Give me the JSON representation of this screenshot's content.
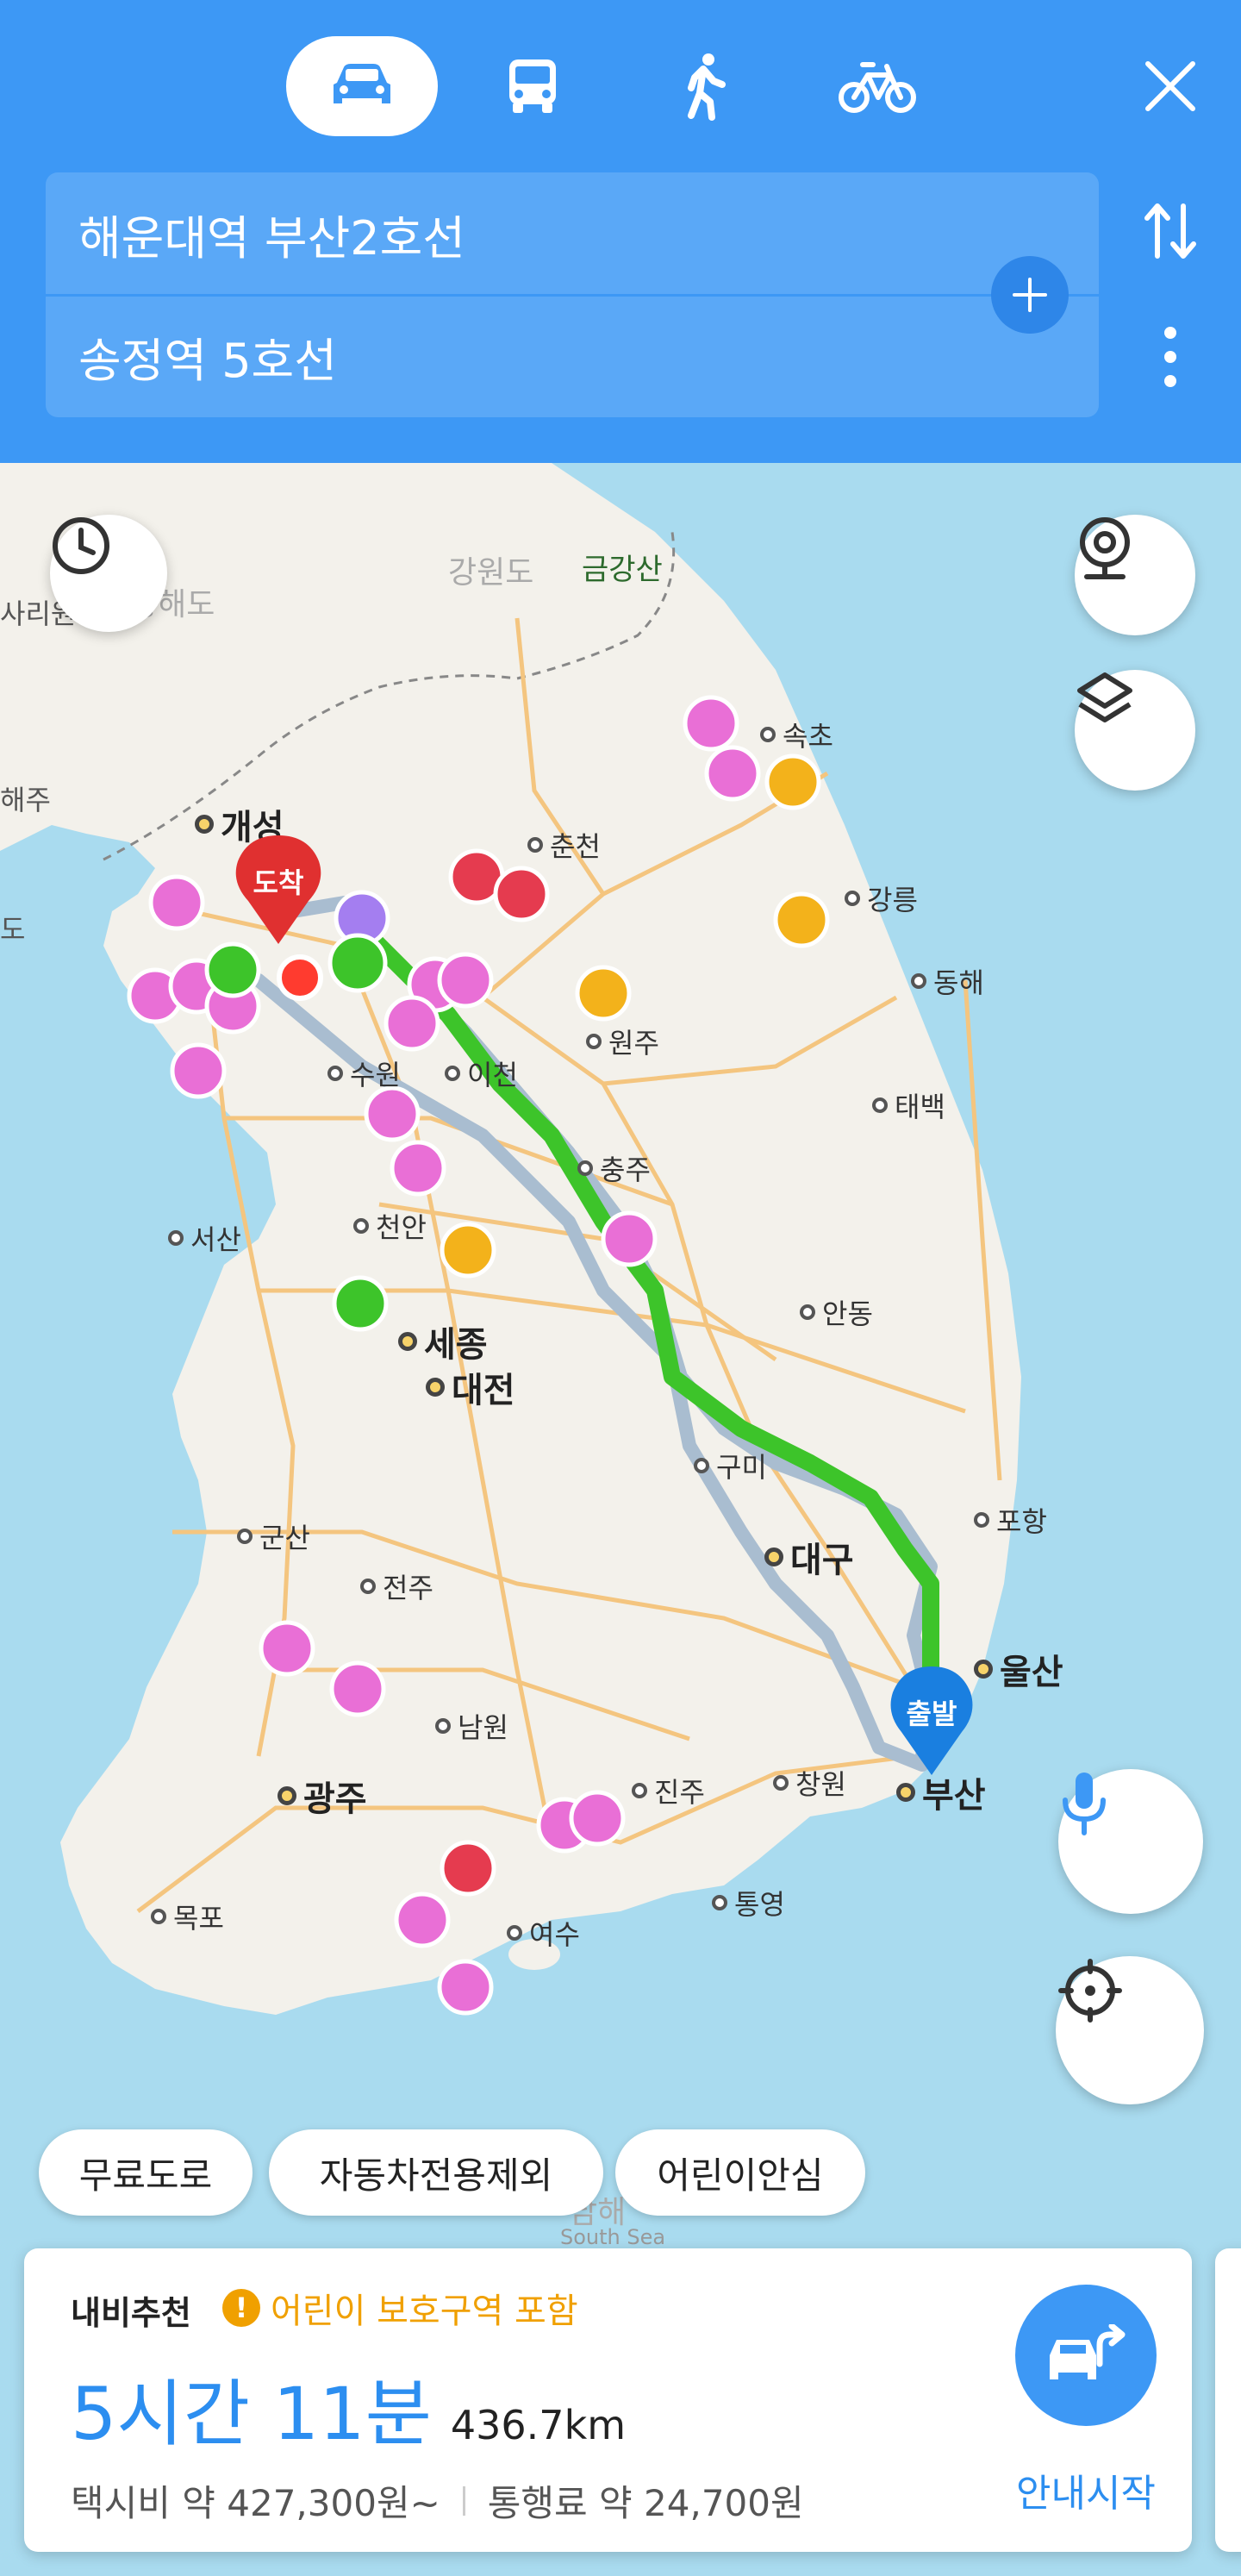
{
  "modes": [
    {
      "icon": "car-icon",
      "active": true
    },
    {
      "icon": "bus-icon",
      "active": false
    },
    {
      "icon": "walk-icon",
      "active": false
    },
    {
      "icon": "bike-icon",
      "active": false
    }
  ],
  "route": {
    "origin": "해운대역 부산2호선",
    "destination": "송정역 5호선"
  },
  "map": {
    "regions": [
      "강원도",
      "금강산",
      "황해도",
      "사리원",
      "해주",
      "남해",
      "South Sea"
    ],
    "cities_small": [
      "속초",
      "춘천",
      "강릉",
      "동해",
      "원주",
      "이천",
      "수원",
      "태백",
      "충주",
      "천안",
      "서산",
      "안동",
      "구미",
      "포항",
      "군산",
      "전주",
      "남원",
      "진주",
      "창원",
      "통영",
      "목포",
      "여수",
      "도"
    ],
    "cities_big": [
      "개성",
      "세종",
      "대전",
      "대구",
      "울산",
      "광주",
      "부산"
    ],
    "markers": {
      "destination": "도착",
      "origin": "출발"
    }
  },
  "filters": [
    "무료도로",
    "자동차전용제외",
    "어린이안심"
  ],
  "result": {
    "title": "내비추천",
    "warning": "어린이 보호구역 포함",
    "duration": "5시간 11분",
    "distance": "436.7km",
    "taxi_fare": "택시비 약 427,300원~",
    "toll": "통행료 약 24,700원",
    "start_label": "안내시작"
  },
  "colors": {
    "header": "#3d98f5",
    "route_main": "#3dc42a",
    "route_alt": "#9fb4c9",
    "accent": "#3d98f5",
    "warning": "#f0a000",
    "destination_pin": "#e03030",
    "origin_pin": "#1a7fe0"
  }
}
